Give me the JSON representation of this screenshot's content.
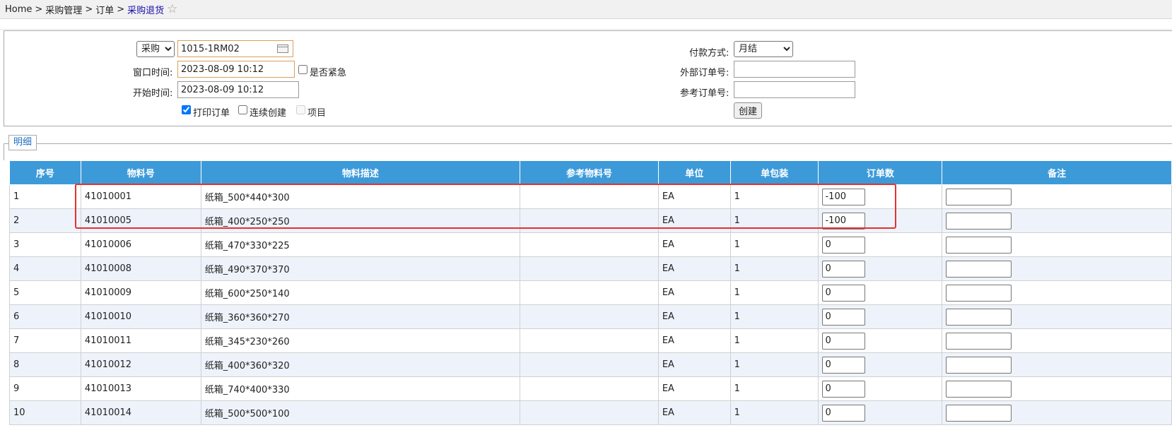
{
  "breadcrumb": {
    "items": [
      "Home",
      "采购管理",
      "订单"
    ],
    "current": "采购退货",
    "separator": ">"
  },
  "form": {
    "type_select": {
      "value": "采购",
      "options": [
        "采购"
      ]
    },
    "supplier_code": "1015-1RM02",
    "window_time": {
      "label": "窗口时间:",
      "value": "2023-08-09 10:12"
    },
    "urgent": {
      "label": "是否紧急",
      "checked": false
    },
    "start_time": {
      "label": "开始时间:",
      "value": "2023-08-09 10:12"
    },
    "print_order": {
      "label": "打印订单",
      "checked": true
    },
    "continuous_create": {
      "label": "连续创建",
      "checked": false
    },
    "project": {
      "label": "项目",
      "checked": false,
      "disabled": true
    },
    "payment_method": {
      "label": "付款方式:",
      "value": "月结",
      "options": [
        "月结"
      ]
    },
    "external_order_no": {
      "label": "外部订单号:",
      "value": ""
    },
    "reference_order_no": {
      "label": "参考订单号:",
      "value": ""
    },
    "create_button": "创建"
  },
  "detail": {
    "legend": "明细",
    "columns": [
      "序号",
      "物料号",
      "物料描述",
      "参考物料号",
      "单位",
      "单包装",
      "订单数",
      "备注"
    ],
    "rows": [
      {
        "no": "1",
        "material": "41010001",
        "desc": "纸箱_500*440*300",
        "ref": "",
        "unit": "EA",
        "pack": "1",
        "qty": "-100",
        "note": ""
      },
      {
        "no": "2",
        "material": "41010005",
        "desc": "纸箱_400*250*250",
        "ref": "",
        "unit": "EA",
        "pack": "1",
        "qty": "-100",
        "note": ""
      },
      {
        "no": "3",
        "material": "41010006",
        "desc": "纸箱_470*330*225",
        "ref": "",
        "unit": "EA",
        "pack": "1",
        "qty": "0",
        "note": ""
      },
      {
        "no": "4",
        "material": "41010008",
        "desc": "纸箱_490*370*370",
        "ref": "",
        "unit": "EA",
        "pack": "1",
        "qty": "0",
        "note": ""
      },
      {
        "no": "5",
        "material": "41010009",
        "desc": "纸箱_600*250*140",
        "ref": "",
        "unit": "EA",
        "pack": "1",
        "qty": "0",
        "note": ""
      },
      {
        "no": "6",
        "material": "41010010",
        "desc": "纸箱_360*360*270",
        "ref": "",
        "unit": "EA",
        "pack": "1",
        "qty": "0",
        "note": ""
      },
      {
        "no": "7",
        "material": "41010011",
        "desc": "纸箱_345*230*260",
        "ref": "",
        "unit": "EA",
        "pack": "1",
        "qty": "0",
        "note": ""
      },
      {
        "no": "8",
        "material": "41010012",
        "desc": "纸箱_400*360*320",
        "ref": "",
        "unit": "EA",
        "pack": "1",
        "qty": "0",
        "note": ""
      },
      {
        "no": "9",
        "material": "41010013",
        "desc": "纸箱_740*400*330",
        "ref": "",
        "unit": "EA",
        "pack": "1",
        "qty": "0",
        "note": ""
      },
      {
        "no": "10",
        "material": "41010014",
        "desc": "纸箱_500*500*100",
        "ref": "",
        "unit": "EA",
        "pack": "1",
        "qty": "0",
        "note": ""
      }
    ]
  },
  "colors": {
    "header_bg": "#3d9ad9",
    "row_alt_bg": "#eef3fb",
    "highlight_border": "#e5302e",
    "link": "#1a0dab",
    "legend_text": "#1f6fc5"
  },
  "icons": {
    "favorite": "star-outline-icon",
    "date_picker": "calendar-icon"
  }
}
